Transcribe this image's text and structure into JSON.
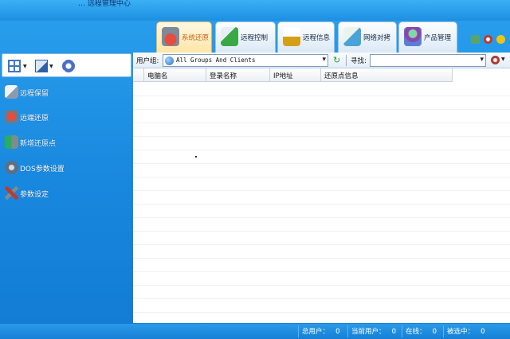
{
  "titlebar": {
    "text": "… 远程管理中心"
  },
  "quick_access": [
    {
      "icon": "edit-icon",
      "color": "#f5f5f5"
    },
    {
      "icon": "folder-icon",
      "color": "#d9e6f3"
    },
    {
      "icon": "folder-open-icon",
      "color": "#d9e6f3"
    },
    {
      "icon": "monitor-icon",
      "color": "#e6edf5"
    },
    {
      "icon": "monitor-check-icon",
      "color": "#e6edf5"
    },
    {
      "icon": "crown-icon",
      "color": "#e8f0f8"
    }
  ],
  "tabs": [
    {
      "label": "系统还原",
      "icon": "restore-disk-icon",
      "color": "#c0392b",
      "active": true
    },
    {
      "label": "远程控制",
      "icon": "remote-control-icon",
      "color": "#39a845",
      "active": false
    },
    {
      "label": "远程信息",
      "icon": "remote-info-icon",
      "color": "#d4a017",
      "active": false
    },
    {
      "label": "网络对拷",
      "icon": "network-copy-icon",
      "color": "#4aa3d8",
      "active": false
    },
    {
      "label": "产品管理",
      "icon": "product-box-icon",
      "color": "#8e44ad",
      "active": false
    }
  ],
  "top_right_icons": [
    {
      "icon": "network-icon",
      "color": "#5aa469"
    },
    {
      "icon": "globe-icon",
      "color": "#c0392b"
    },
    {
      "icon": "help-icon",
      "color": "#f1c40f"
    }
  ],
  "left_toolbar": [
    {
      "icon": "view-grid-icon",
      "color": "#3c78c4"
    },
    {
      "icon": "edit-list-icon",
      "color": "#2f5fa8"
    },
    {
      "icon": "gear-icon",
      "color": "#4a6fc7"
    }
  ],
  "nav": [
    {
      "label": "远程保留",
      "icon": "remote-keep-icon",
      "color": "#d9dfe7"
    },
    {
      "label": "远端还原",
      "icon": "remote-restore-icon",
      "color": "#c0392b"
    },
    {
      "label": "新增还原点",
      "icon": "add-restore-point-icon",
      "color": "#27ae60"
    },
    {
      "label": "DOS参数设置",
      "icon": "dos-settings-icon",
      "color": "#5b6f85"
    },
    {
      "label": "参数设定",
      "icon": "tools-icon",
      "color": "#c0392b"
    }
  ],
  "filter": {
    "group_label": "用户组:",
    "group_value": "All Groups And Clients",
    "search_label": "寻找:",
    "search_value": ""
  },
  "table": {
    "columns": [
      "",
      "电脑名",
      "登录名称",
      "IP地址",
      "还原点信息"
    ],
    "rows": []
  },
  "status": {
    "total_users_label": "总用户：",
    "total_users": "0",
    "current_users_label": "当前用户：",
    "current_users": "0",
    "online_label": "在线：",
    "online": "0",
    "selected_label": "被选中：",
    "selected": "0"
  }
}
